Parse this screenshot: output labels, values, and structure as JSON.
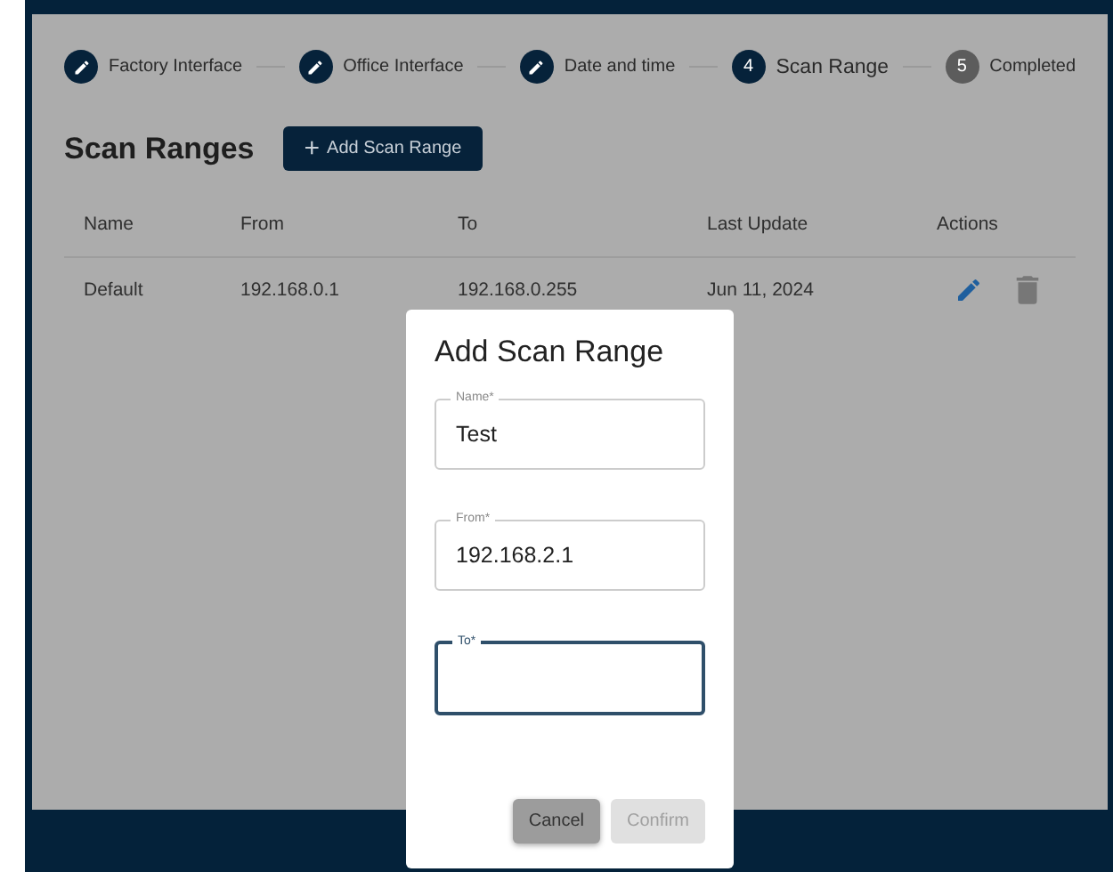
{
  "stepper": [
    {
      "label": "Factory Interface",
      "completed": true,
      "selected": false
    },
    {
      "label": "Office Interface",
      "completed": true,
      "selected": false
    },
    {
      "label": "Date and time",
      "completed": true,
      "selected": false
    },
    {
      "label": "Scan Range",
      "completed": false,
      "selected": true,
      "number": "4"
    },
    {
      "label": "Completed",
      "completed": false,
      "selected": false,
      "number": "5"
    }
  ],
  "page": {
    "title": "Scan Ranges",
    "add_button": {
      "icon": "+",
      "label": "Add Scan Range"
    }
  },
  "table": {
    "columns": [
      "Name",
      "From",
      "To",
      "Last Update",
      "Actions"
    ],
    "rows": [
      {
        "cells": [
          "Default",
          "192.168.0.1",
          "192.168.0.255",
          "Jun 11, 2024"
        ]
      }
    ]
  },
  "dialog": {
    "title": "Add Scan Range",
    "fields": [
      {
        "label": "Name*",
        "value": "Test",
        "focused": false
      },
      {
        "label": "From*",
        "value": "192.168.2.1",
        "focused": false
      },
      {
        "label": "To*",
        "focused": true
      }
    ],
    "buttons": [
      {
        "label": "Cancel",
        "disabled": false
      },
      {
        "label": "Confirm",
        "disabled": true
      }
    ]
  }
}
